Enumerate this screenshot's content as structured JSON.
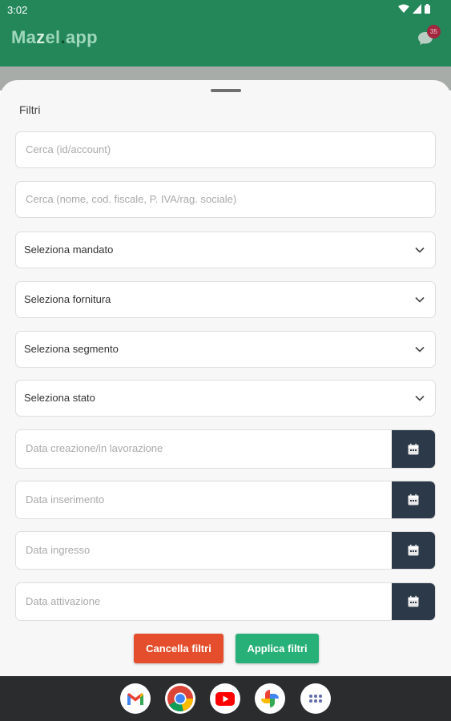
{
  "status_bar": {
    "time": "3:02"
  },
  "app_bar": {
    "title_parts": [
      "Ma",
      "z",
      "el",
      ".",
      "app"
    ],
    "notification_count": "35"
  },
  "filters": {
    "title": "Filtri",
    "search_id_placeholder": "Cerca (id/account)",
    "search_name_placeholder": "Cerca (nome, cod. fiscale, P. IVA/rag. sociale)",
    "selects": [
      {
        "label": "Seleziona mandato"
      },
      {
        "label": "Seleziona fornitura"
      },
      {
        "label": "Seleziona segmento"
      },
      {
        "label": "Seleziona stato"
      }
    ],
    "date_fields": [
      {
        "placeholder": "Data creazione/in lavorazione"
      },
      {
        "placeholder": "Data inserimento"
      },
      {
        "placeholder": "Data ingresso"
      },
      {
        "placeholder": "Data attivazione"
      }
    ],
    "clear_button": "Cancella filtri",
    "apply_button": "Applica filtri"
  },
  "dock": [
    "gmail-icon",
    "chrome-icon",
    "youtube-icon",
    "photos-icon",
    "app-drawer-icon"
  ],
  "colors": {
    "primary": "#23875a",
    "clear": "#e44e2c",
    "apply": "#27b077",
    "calendar_button": "#2b3949",
    "badge": "#a3263f"
  }
}
